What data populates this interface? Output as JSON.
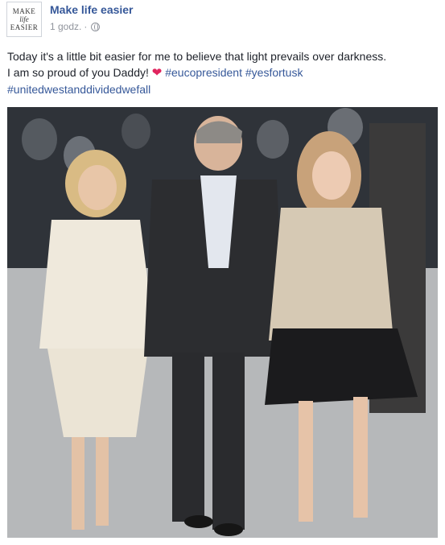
{
  "header": {
    "avatar_lines": [
      "MAKE",
      "life",
      "EASIER"
    ],
    "page_name": "Make life easier",
    "timestamp": "1 godz.",
    "separator": "·",
    "audience_icon": "globe-icon"
  },
  "post": {
    "line1": "Today it's a little bit easier for me to believe that light prevails over darkness.",
    "line2_text": "I am so proud of you Daddy!",
    "heart": "❤",
    "hashtags": [
      "#eucopresident",
      "#yesfortusk",
      "#unitedwestanddividedwefall"
    ]
  },
  "photo": {
    "description_icon": "photo"
  }
}
